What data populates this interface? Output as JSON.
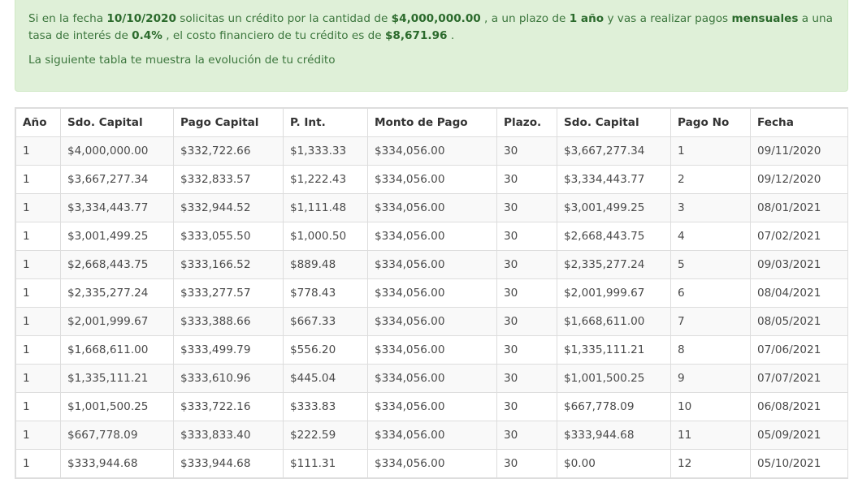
{
  "summary": {
    "t1": "Si en la fecha ",
    "date": "10/10/2020",
    "t2": " solicitas un crédito por la cantidad de ",
    "amount": "$4,000,000.00",
    "t3": " , a un plazo de ",
    "term": "1 año",
    "t4": " y vas a realizar pagos ",
    "freq": "mensuales",
    "t5": " a una tasa de interés de ",
    "rate": "0.4%",
    "t6": " , el costo financiero de tu crédito es de ",
    "cost": "$8,671.96",
    "t7": " .",
    "note": "La siguiente tabla te muestra la evolución de tu crédito"
  },
  "table": {
    "headers": [
      "Año",
      "Sdo. Capital",
      "Pago Capital",
      "P. Int.",
      "Monto de Pago",
      "Plazo.",
      "Sdo. Capital",
      "Pago No",
      "Fecha"
    ],
    "rows": [
      [
        "1",
        "$4,000,000.00",
        "$332,722.66",
        "$1,333.33",
        "$334,056.00",
        "30",
        "$3,667,277.34",
        "1",
        "09/11/2020"
      ],
      [
        "1",
        "$3,667,277.34",
        "$332,833.57",
        "$1,222.43",
        "$334,056.00",
        "30",
        "$3,334,443.77",
        "2",
        "09/12/2020"
      ],
      [
        "1",
        "$3,334,443.77",
        "$332,944.52",
        "$1,111.48",
        "$334,056.00",
        "30",
        "$3,001,499.25",
        "3",
        "08/01/2021"
      ],
      [
        "1",
        "$3,001,499.25",
        "$333,055.50",
        "$1,000.50",
        "$334,056.00",
        "30",
        "$2,668,443.75",
        "4",
        "07/02/2021"
      ],
      [
        "1",
        "$2,668,443.75",
        "$333,166.52",
        "$889.48",
        "$334,056.00",
        "30",
        "$2,335,277.24",
        "5",
        "09/03/2021"
      ],
      [
        "1",
        "$2,335,277.24",
        "$333,277.57",
        "$778.43",
        "$334,056.00",
        "30",
        "$2,001,999.67",
        "6",
        "08/04/2021"
      ],
      [
        "1",
        "$2,001,999.67",
        "$333,388.66",
        "$667.33",
        "$334,056.00",
        "30",
        "$1,668,611.00",
        "7",
        "08/05/2021"
      ],
      [
        "1",
        "$1,668,611.00",
        "$333,499.79",
        "$556.20",
        "$334,056.00",
        "30",
        "$1,335,111.21",
        "8",
        "07/06/2021"
      ],
      [
        "1",
        "$1,335,111.21",
        "$333,610.96",
        "$445.04",
        "$334,056.00",
        "30",
        "$1,001,500.25",
        "9",
        "07/07/2021"
      ],
      [
        "1",
        "$1,001,500.25",
        "$333,722.16",
        "$333.83",
        "$334,056.00",
        "30",
        "$667,778.09",
        "10",
        "06/08/2021"
      ],
      [
        "1",
        "$667,778.09",
        "$333,833.40",
        "$222.59",
        "$334,056.00",
        "30",
        "$333,944.68",
        "11",
        "05/09/2021"
      ],
      [
        "1",
        "$333,944.68",
        "$333,944.68",
        "$111.31",
        "$334,056.00",
        "30",
        "$0.00",
        "12",
        "05/10/2021"
      ]
    ]
  },
  "colors": {
    "alert_bg": "#dff0d8",
    "alert_text": "#3c763d",
    "row_stripe": "#f9f9f9",
    "border": "#dddddd"
  }
}
